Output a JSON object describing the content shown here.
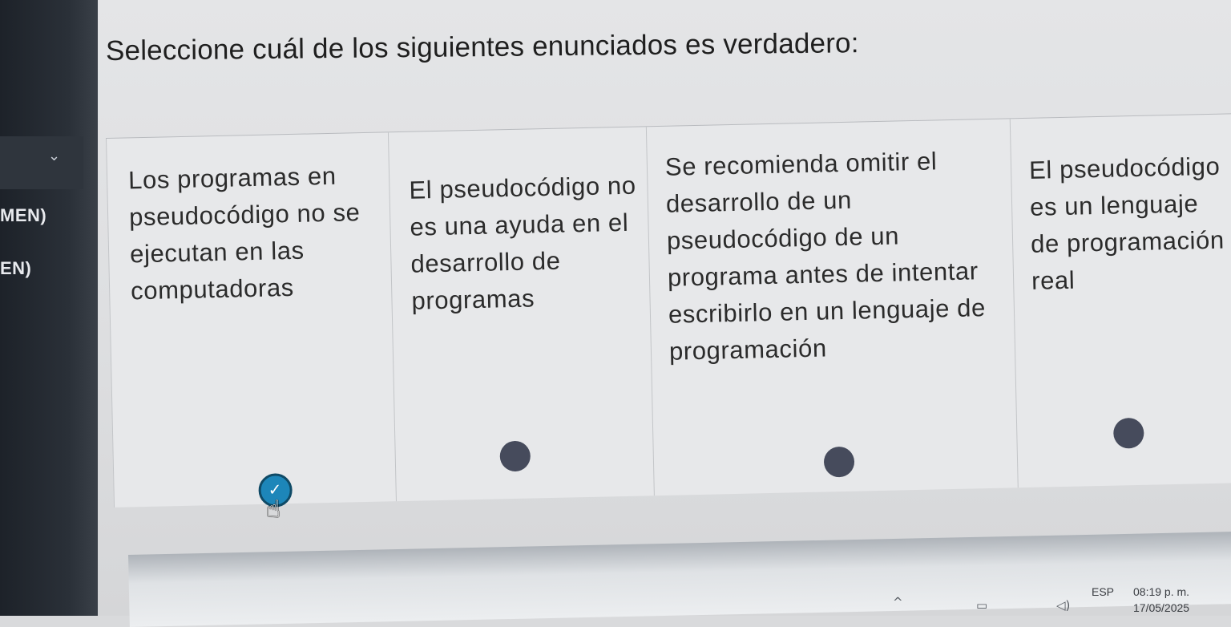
{
  "sidebar": {
    "items": [
      {
        "label": "MEN)"
      },
      {
        "label": "EN)"
      }
    ],
    "collapse_icon": "chevron-down-icon"
  },
  "question": {
    "text": "Seleccione cuál de los siguientes enunciados es verdadero:"
  },
  "options": [
    {
      "text": "Los programas en pseudocódigo no se ejecutan en las computadoras",
      "selected": true
    },
    {
      "text": "El pseudocódigo no es una ayuda en el desarrollo de programas",
      "selected": false
    },
    {
      "text": "Se recomienda omitir el desarrollo de un pseudocódigo de un programa antes de intentar escribirlo en un lenguaje de programación",
      "selected": false
    },
    {
      "text": "El pseudocódigo es un lenguaje de programación real",
      "selected": false
    }
  ],
  "taskbar": {
    "language": "ESP",
    "time": "08:19 p. m.",
    "date": "17/05/2025",
    "icons": [
      "chevron-up-icon",
      "network-icon",
      "speaker-icon"
    ]
  },
  "colors": {
    "selected_radio": "#1d86b9",
    "unselected_radio": "#464b5c",
    "sidebar": "#1d2229"
  }
}
